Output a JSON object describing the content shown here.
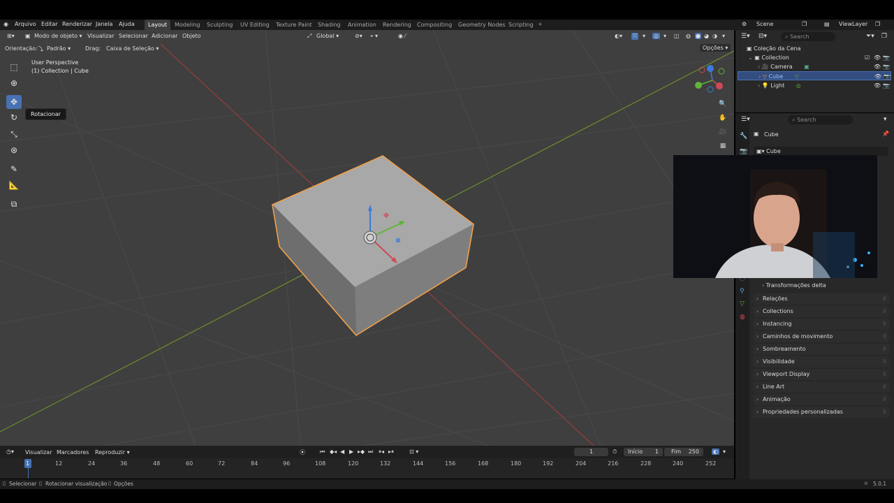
{
  "menubar": {
    "file": "Arquivo",
    "edit": "Editar",
    "render": "Renderizar",
    "window": "Janela",
    "help": "Ajuda"
  },
  "workspaces": [
    "Layout",
    "Modeling",
    "Sculpting",
    "UV Editing",
    "Texture Paint",
    "Shading",
    "Animation",
    "Rendering",
    "Compositing",
    "Geometry Nodes",
    "Scripting"
  ],
  "scene": {
    "scene_label": "Scene",
    "viewlayer_label": "ViewLayer"
  },
  "viewport_header": {
    "mode": "Modo de objeto",
    "view": "Visualizar",
    "select": "Selecionar",
    "add": "Adicionar",
    "object": "Objeto",
    "transform_space": "Global",
    "orientation_label": "Orientação:",
    "orientation_value": "Padrão",
    "drag_label": "Drag:",
    "drag_value": "Caixa de Seleção",
    "options": "Opções"
  },
  "viewport_overlay": {
    "perspective": "User Perspective",
    "collection": "(1) Collection | Cube"
  },
  "tooltip": "Rotacionar",
  "outliner": {
    "search_placeholder": "Search",
    "scene_collection": "Coleção da Cena",
    "collection": "Collection",
    "items": [
      "Camera",
      "Cube",
      "Light"
    ]
  },
  "properties": {
    "search_placeholder": "Search",
    "object_name": "Cube",
    "data_name": "Cube",
    "panels": [
      "Transformações delta",
      "Relações",
      "Collections",
      "Instancing",
      "Caminhos de movimento",
      "Sombreamento",
      "Visibilidade",
      "Viewport Display",
      "Line Art",
      "Animação",
      "Propriedades personalizadas"
    ]
  },
  "timeline": {
    "view": "Visualizar",
    "markers": "Marcadores",
    "playback": "Reproduzir",
    "current_frame": "1",
    "start_label": "Início",
    "start_value": "1",
    "end_label": "Fim",
    "end_value": "250",
    "ticks": [
      "1",
      "12",
      "24",
      "36",
      "48",
      "60",
      "72",
      "84",
      "96",
      "108",
      "120",
      "132",
      "144",
      "156",
      "168",
      "180",
      "192",
      "204",
      "216",
      "228",
      "240",
      "252"
    ]
  },
  "statusbar": {
    "select": "Selecionar",
    "rotate_view": "Rotacionar visualização",
    "options": "Opções",
    "version": "5.0.1"
  },
  "colors": {
    "accent": "#4772b3",
    "selected_outline": "#f0a04b",
    "x_axis": "#b84a4a",
    "y_axis": "#7aa33a"
  }
}
